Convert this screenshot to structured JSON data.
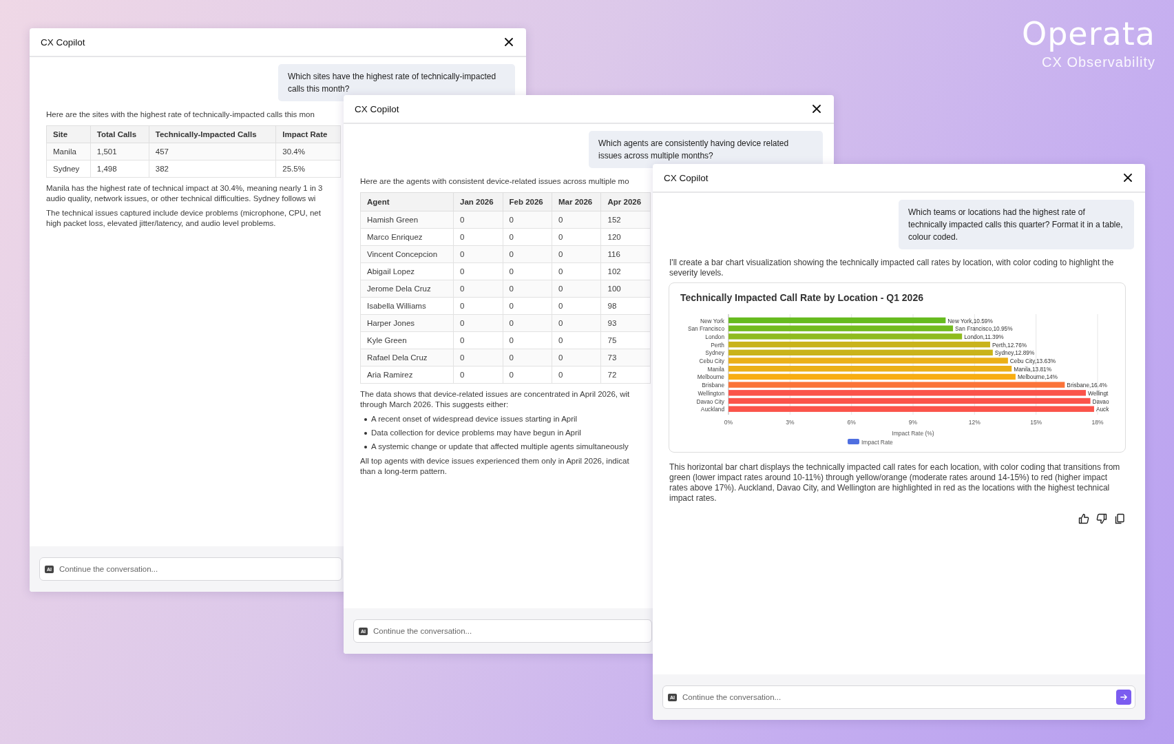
{
  "brand": {
    "logo": "Operata",
    "tagline": "CX Observability"
  },
  "windows": [
    {
      "title": "CX Copilot",
      "question": "Which sites have the highest rate of technically-impacted calls this month?",
      "blocks": [
        {
          "kind": "cut_lines",
          "lines": [
            "Here are the sites with the highest rate of technically-impacted calls this mon"
          ]
        },
        {
          "kind": "table",
          "columns": [
            "Site",
            "Total Calls",
            "Technically-Impacted Calls",
            "Impact Rate"
          ],
          "rows": [
            [
              "Manila",
              "1,501",
              "457",
              "30.4%"
            ],
            [
              "Sydney",
              "1,498",
              "382",
              "25.5%"
            ]
          ]
        },
        {
          "kind": "cut_lines",
          "lines": [
            "Manila has the highest rate of technical impact at 30.4%, meaning nearly 1 in 3",
            "audio quality, network issues, or other technical difficulties. Sydney follows wi"
          ]
        },
        {
          "kind": "cut_lines",
          "lines": [
            "The technical issues captured include device problems (microphone, CPU, net",
            "high packet loss, elevated jitter/latency, and audio level problems."
          ]
        }
      ],
      "input": {
        "badge": "AI",
        "placeholder": "Continue the conversation...",
        "send_button": false
      }
    },
    {
      "title": "CX Copilot",
      "question": "Which agents are consistently having device related issues across multiple months?",
      "blocks": [
        {
          "kind": "cut_lines",
          "lines": [
            "Here are the agents with consistent device-related issues across multiple mo"
          ]
        },
        {
          "kind": "table",
          "columns": [
            "Agent",
            "Jan 2026",
            "Feb 2026",
            "Mar 2026",
            "Apr 2026"
          ],
          "rows": [
            [
              "Hamish Green",
              "0",
              "0",
              "0",
              "152"
            ],
            [
              "Marco Enriquez",
              "0",
              "0",
              "0",
              "120"
            ],
            [
              "Vincent Concepcion",
              "0",
              "0",
              "0",
              "116"
            ],
            [
              "Abigail Lopez",
              "0",
              "0",
              "0",
              "102"
            ],
            [
              "Jerome Dela Cruz",
              "0",
              "0",
              "0",
              "100"
            ],
            [
              "Isabella Williams",
              "0",
              "0",
              "0",
              "98"
            ],
            [
              "Harper Jones",
              "0",
              "0",
              "0",
              "93"
            ],
            [
              "Kyle Green",
              "0",
              "0",
              "0",
              "75"
            ],
            [
              "Rafael Dela Cruz",
              "0",
              "0",
              "0",
              "73"
            ],
            [
              "Aria Ramirez",
              "0",
              "0",
              "0",
              "72"
            ]
          ]
        },
        {
          "kind": "cut_lines",
          "lines": [
            "The data shows that device-related issues are concentrated in April 2026, wit",
            "through March 2026. This suggests either:"
          ]
        },
        {
          "kind": "bullets",
          "items": [
            "A recent onset of widespread device issues starting in April",
            "Data collection for device problems may have begun in April",
            "A systemic change or update that affected multiple agents simultaneously"
          ]
        },
        {
          "kind": "cut_lines",
          "lines": [
            "All top agents with device issues experienced them only in April 2026, indicat",
            "than a long-term pattern."
          ]
        }
      ],
      "input": {
        "badge": "AI",
        "placeholder": "Continue the conversation...",
        "send_button": false
      }
    },
    {
      "title": "CX Copilot",
      "question": "Which teams or locations had the highest rate of technically impacted calls this quarter? Format it in a table, colour coded.",
      "blocks": [
        {
          "kind": "paragraph",
          "text": "I'll create a bar chart visualization showing the technically impacted call rates by location, with color coding to highlight the severity levels."
        },
        {
          "kind": "chart",
          "chart_data": {
            "type": "bar",
            "orientation": "horizontal",
            "title": "Technically Impacted Call Rate by Location - Q1 2026",
            "xlabel": "Impact Rate (%)",
            "categories": [
              "New York",
              "San Francisco",
              "London",
              "Perth",
              "Sydney",
              "Cebu City",
              "Manila",
              "Melbourne",
              "Brisbane",
              "Wellington",
              "Davao City",
              "Auckland"
            ],
            "series": [
              {
                "name": "Impact Rate",
                "values": [
                  10.59,
                  10.95,
                  11.39,
                  12.76,
                  12.89,
                  13.63,
                  13.81,
                  14,
                  16.4,
                  17.43,
                  17.65,
                  17.83
                ]
              }
            ],
            "xlim": [
              0,
              18
            ],
            "grid": true,
            "xticks": [
              {
                "value": 0,
                "label": "0%"
              },
              {
                "value": 3,
                "label": "3%"
              },
              {
                "value": 6,
                "label": "6%"
              },
              {
                "value": 9,
                "label": "9%"
              },
              {
                "value": 12,
                "label": "12%"
              },
              {
                "value": 15,
                "label": "15%"
              },
              {
                "value": 18,
                "label": "18%"
              }
            ],
            "data_labels": "value_labels",
            "value_labels": [
              "New York,10.59%",
              "San Francisco,10.95%",
              "London,11.39%",
              "Perth,12.76%",
              "Sydney,12.89%",
              "Cebu City,13.63%",
              "Manila,13.81%",
              "Melbourne,14%",
              "Brisbane,16.4%",
              "Wellingt",
              "Davao",
              "Auck"
            ]
          }
        },
        {
          "kind": "paragraph",
          "text": "This horizontal bar chart displays the technically impacted call rates for each location, with color coding that transitions from green (lower impact rates around 10-11%) through yellow/orange (moderate rates around 14-15%) to red (higher impact rates above 17%). Auckland, Davao City, and Wellington are highlighted in red as the locations with the highest technical impact rates."
        }
      ],
      "actions": [
        {
          "kind": "thumbs_up"
        },
        {
          "kind": "thumbs_down"
        },
        {
          "kind": "copy"
        }
      ],
      "input": {
        "badge": "AI",
        "placeholder": "Continue the conversation...",
        "send_button": true
      }
    }
  ]
}
